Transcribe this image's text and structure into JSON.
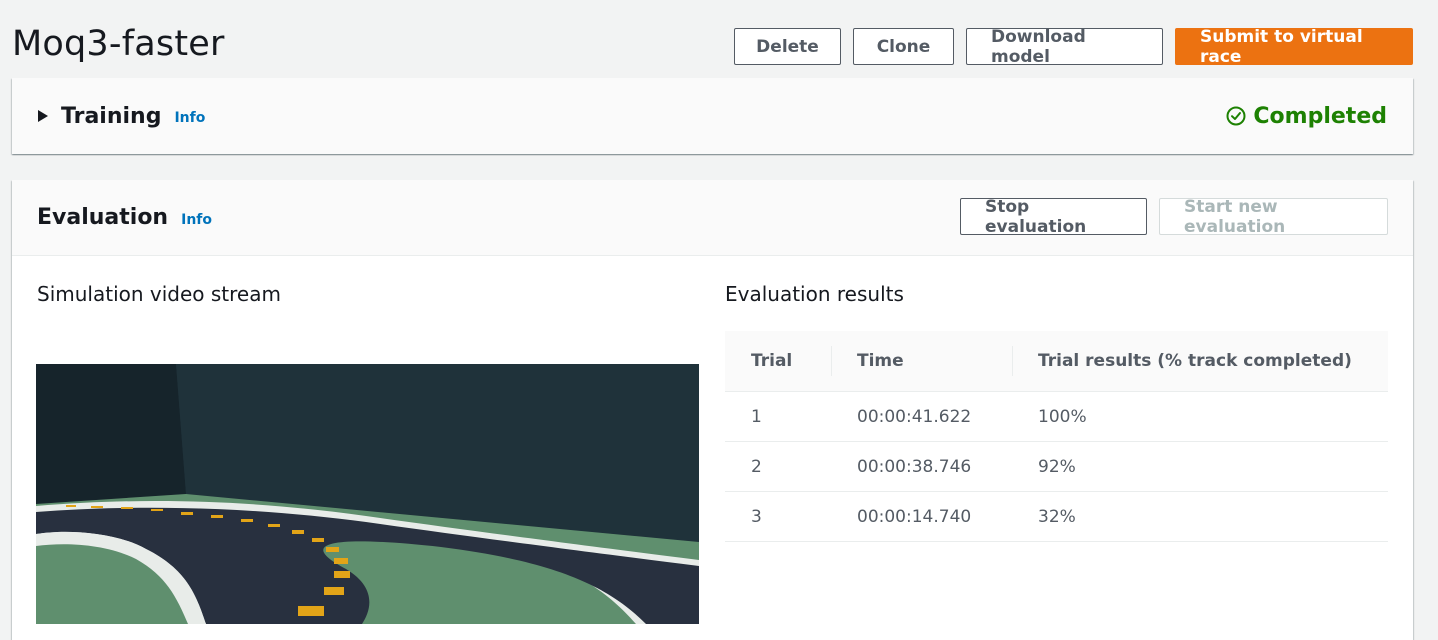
{
  "page": {
    "title": "Moq3-faster"
  },
  "actions": {
    "delete": "Delete",
    "clone": "Clone",
    "download": "Download model",
    "submit": "Submit to virtual race"
  },
  "training": {
    "title": "Training",
    "info": "Info",
    "status": "Completed",
    "status_color": "#1d8102"
  },
  "evaluation": {
    "title": "Evaluation",
    "info": "Info",
    "stop_label": "Stop evaluation",
    "start_label": "Start new evaluation",
    "video_title": "Simulation video stream",
    "results_title": "Evaluation results",
    "columns": [
      "Trial",
      "Time",
      "Trial results (% track completed)"
    ],
    "rows": [
      {
        "trial": "1",
        "time": "00:00:41.622",
        "result": "100%"
      },
      {
        "trial": "2",
        "time": "00:00:38.746",
        "result": "92%"
      },
      {
        "trial": "3",
        "time": "00:00:14.740",
        "result": "32%"
      }
    ]
  },
  "colors": {
    "accent": "#ec7211",
    "link": "#0073bb"
  }
}
